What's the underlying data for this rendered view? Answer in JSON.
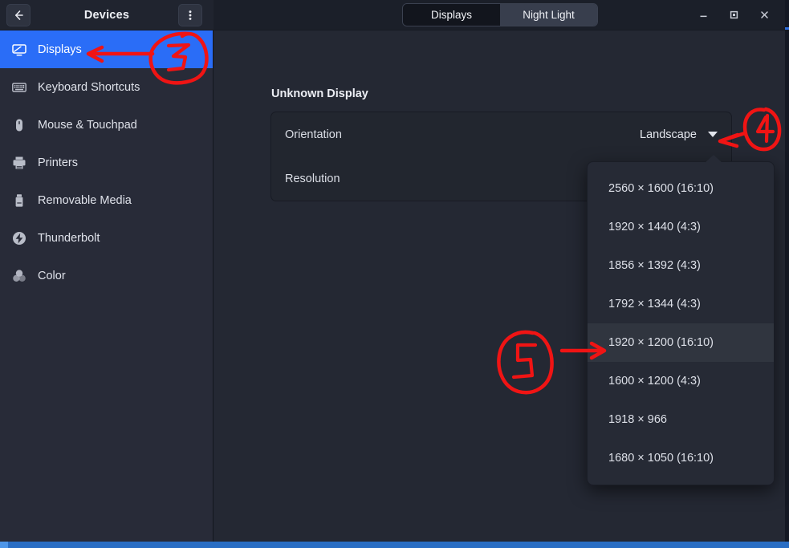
{
  "window": {
    "title": "Devices",
    "back_label": "←",
    "menu_label": "⋮",
    "controls": {
      "minimize": "—",
      "maximize": "□",
      "close": "✕"
    }
  },
  "tabs": [
    {
      "label": "Displays",
      "active": true
    },
    {
      "label": "Night Light",
      "active": false
    }
  ],
  "sidebar": {
    "items": [
      {
        "label": "Displays",
        "icon": "monitor-icon",
        "selected": true
      },
      {
        "label": "Keyboard Shortcuts",
        "icon": "keyboard-icon",
        "selected": false
      },
      {
        "label": "Mouse & Touchpad",
        "icon": "mouse-icon",
        "selected": false
      },
      {
        "label": "Printers",
        "icon": "printer-icon",
        "selected": false
      },
      {
        "label": "Removable Media",
        "icon": "usb-drive-icon",
        "selected": false
      },
      {
        "label": "Thunderbolt",
        "icon": "thunderbolt-icon",
        "selected": false
      },
      {
        "label": "Color",
        "icon": "color-wheel-icon",
        "selected": false
      }
    ]
  },
  "main": {
    "section_title": "Unknown Display",
    "rows": [
      {
        "label": "Orientation",
        "value": "Landscape"
      },
      {
        "label": "Resolution",
        "value": "1918 × 966"
      }
    ]
  },
  "dropdown": {
    "open": true,
    "items": [
      {
        "label": "2560 × 1600 (16:10)",
        "highlighted": false
      },
      {
        "label": "1920 × 1440 (4:3)",
        "highlighted": false
      },
      {
        "label": "1856 × 1392 (4:3)",
        "highlighted": false
      },
      {
        "label": "1792 × 1344 (4:3)",
        "highlighted": false
      },
      {
        "label": "1920 × 1200 (16:10)",
        "highlighted": true
      },
      {
        "label": "1600 × 1200 (4:3)",
        "highlighted": false
      },
      {
        "label": "1918 × 966",
        "highlighted": false
      },
      {
        "label": "1680 × 1050 (16:10)",
        "highlighted": false
      }
    ]
  },
  "annotations": {
    "color": "#f01414",
    "marks": [
      {
        "number": "3",
        "target": "sidebar-item-displays"
      },
      {
        "number": "4",
        "target": "resolution-dropdown-caret"
      },
      {
        "number": "5",
        "target": "dropdown-item-1920x1200"
      }
    ]
  },
  "colors": {
    "accent_blue": "#2a6df7",
    "sidebar_bg": "#282b38",
    "main_bg": "#242833",
    "card_bg": "#22262f",
    "popup_bg": "#262a35",
    "annotation_red": "#f01414"
  }
}
